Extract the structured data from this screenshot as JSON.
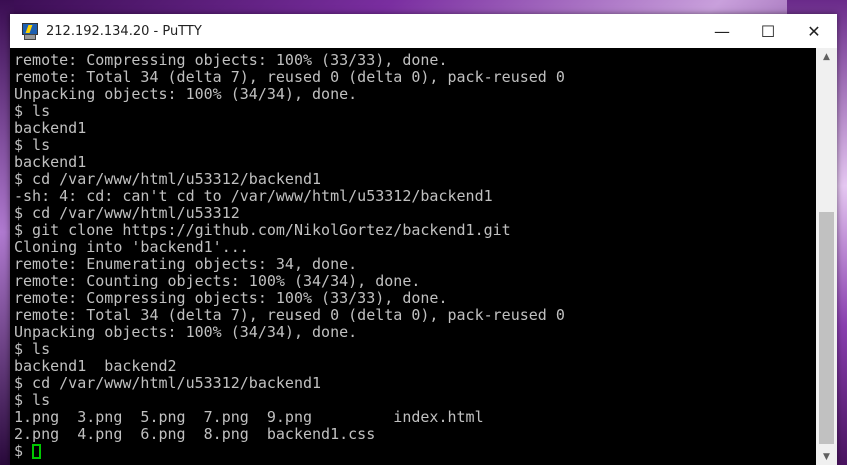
{
  "window": {
    "title": "212.192.134.20 - PuTTY",
    "controls": {
      "minimize": "—",
      "maximize": "☐",
      "close": "✕"
    }
  },
  "terminal": {
    "lines": [
      "remote: Compressing objects: 100% (33/33), done.",
      "remote: Total 34 (delta 7), reused 0 (delta 0), pack-reused 0",
      "Unpacking objects: 100% (34/34), done.",
      "$ ls",
      "backend1",
      "$ ls",
      "backend1",
      "$ cd /var/www/html/u53312/backend1",
      "-sh: 4: cd: can't cd to /var/www/html/u53312/backend1",
      "$ cd /var/www/html/u53312",
      "$ git clone https://github.com/NikolGortez/backend1.git",
      "Cloning into 'backend1'...",
      "remote: Enumerating objects: 34, done.",
      "remote: Counting objects: 100% (34/34), done.",
      "remote: Compressing objects: 100% (33/33), done.",
      "remote: Total 34 (delta 7), reused 0 (delta 0), pack-reused 0",
      "Unpacking objects: 100% (34/34), done.",
      "$ ls",
      "backend1  backend2",
      "$ cd /var/www/html/u53312/backend1",
      "$ ls",
      "1.png  3.png  5.png  7.png  9.png         index.html",
      "2.png  4.png  6.png  8.png  backend1.css"
    ],
    "prompt": "$ ",
    "colors": {
      "text": "#c0c0c0",
      "cursor": "#00c800",
      "background": "#000000"
    }
  },
  "scrollbar": {
    "up_icon": "▲",
    "down_icon": "▼"
  }
}
